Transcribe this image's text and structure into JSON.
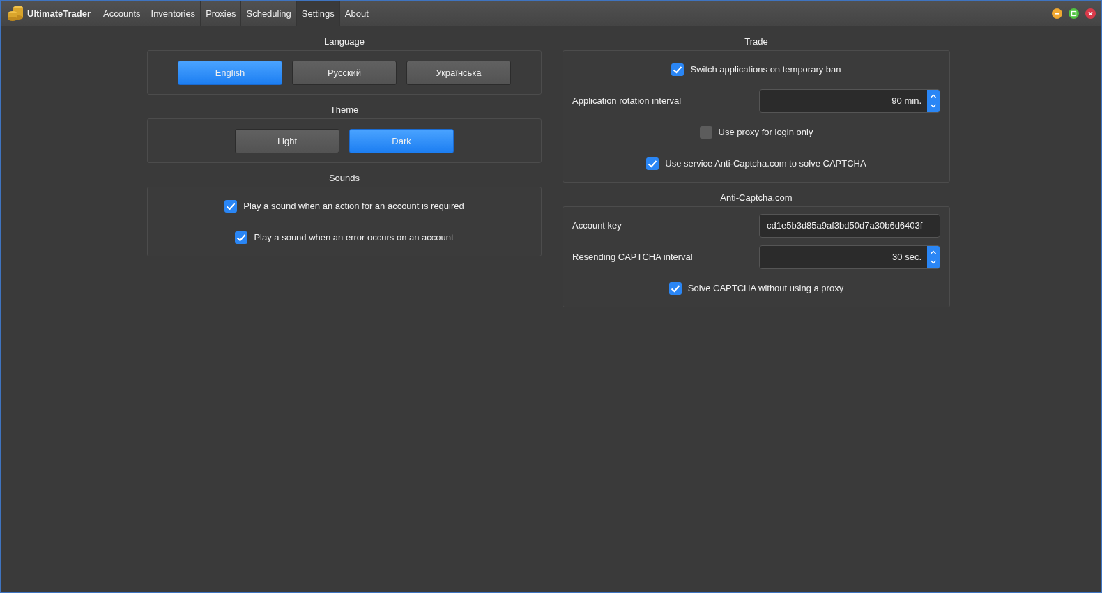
{
  "app": {
    "title": "UltimateTrader"
  },
  "tabs": [
    {
      "label": "Accounts",
      "selected": false
    },
    {
      "label": "Inventories",
      "selected": false
    },
    {
      "label": "Proxies",
      "selected": false
    },
    {
      "label": "Scheduling",
      "selected": false
    },
    {
      "label": "Settings",
      "selected": true
    },
    {
      "label": "About",
      "selected": false
    }
  ],
  "columns": [
    [
      {
        "title": "Language",
        "rows": [
          {
            "kind": "options",
            "options": [
              {
                "label": "English",
                "selected": true
              },
              {
                "label": "Русский",
                "selected": false
              },
              {
                "label": "Українська",
                "selected": false
              }
            ]
          }
        ]
      },
      {
        "title": "Theme",
        "rows": [
          {
            "kind": "options",
            "options": [
              {
                "label": "Light",
                "selected": false
              },
              {
                "label": "Dark",
                "selected": true
              }
            ]
          }
        ]
      },
      {
        "title": "Sounds",
        "rows": [
          {
            "kind": "checkbox",
            "label": "Play a sound when an action for an account is required",
            "checked": true
          },
          {
            "kind": "checkbox",
            "label": "Play a sound when an error occurs on an account",
            "checked": true
          }
        ]
      }
    ],
    [
      {
        "title": "Trade",
        "rows": [
          {
            "kind": "checkbox",
            "label": "Switch applications on temporary ban",
            "checked": true
          },
          {
            "kind": "spinner",
            "label": "Application rotation interval",
            "value": "90 min."
          },
          {
            "kind": "checkbox",
            "label": "Use proxy for login only",
            "checked": false
          },
          {
            "kind": "checkbox",
            "label": "Use service Anti-Captcha.com to solve CAPTCHA",
            "checked": true
          }
        ]
      },
      {
        "title": "Anti-Captcha.com",
        "rows": [
          {
            "kind": "text",
            "label": "Account key",
            "value": "cd1e5b3d85a9af3bd50d7a30b6d6403f"
          },
          {
            "kind": "spinner",
            "label": "Resending CAPTCHA interval",
            "value": "30 sec."
          },
          {
            "kind": "checkbox",
            "label": "Solve CAPTCHA without using a proxy",
            "checked": true
          }
        ]
      }
    ]
  ]
}
